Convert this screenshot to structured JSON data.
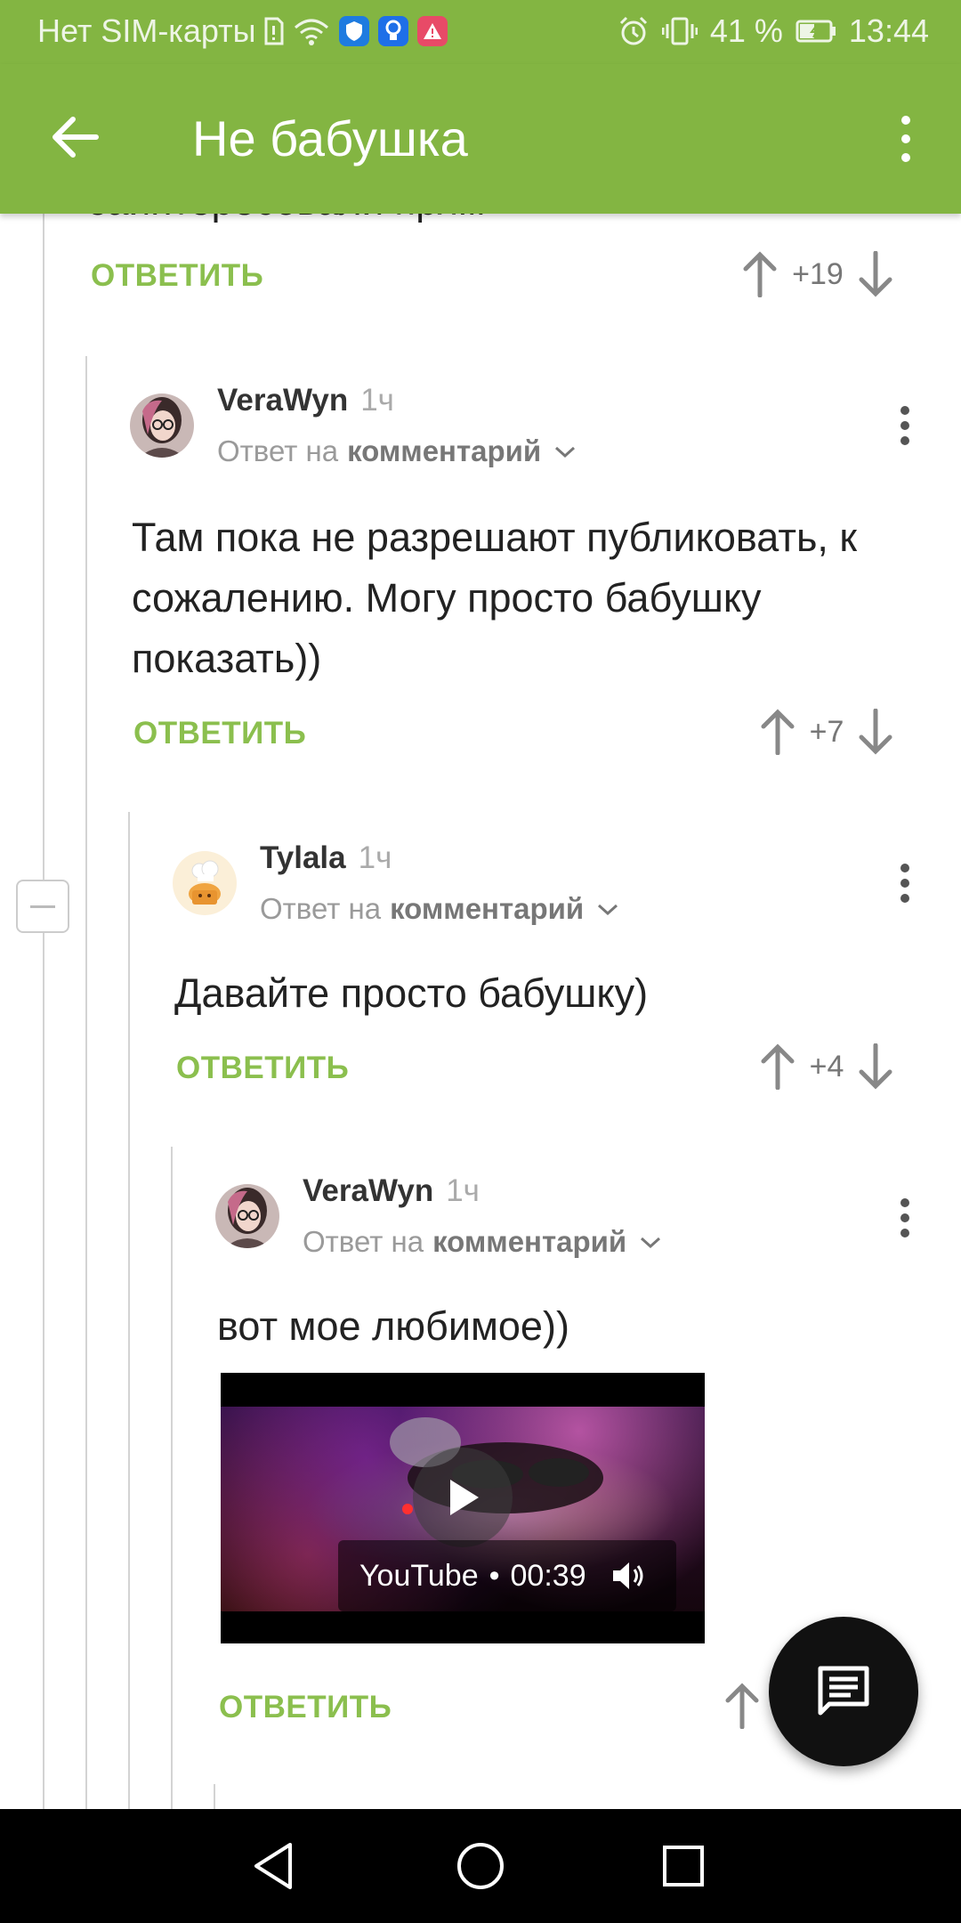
{
  "status_bar": {
    "carrier": "Нет SIM-карты",
    "battery_percent": "41 %",
    "time": "13:44",
    "icons": [
      "sim-icon",
      "wifi-icon",
      "shield-app-icon",
      "bulb-app-icon",
      "warning-app-icon",
      "alarm-icon",
      "vibrate-icon",
      "battery-icon"
    ]
  },
  "appbar": {
    "title": "Не бабушка",
    "back_icon": "arrow-left-icon",
    "menu_icon": "more-vert-icon",
    "background": "#83b542"
  },
  "truncated_comment": {
    "text_fragment": "заинтересовали прям",
    "reply_label": "ОТВЕТИТЬ",
    "score": "+19"
  },
  "comments": [
    {
      "author": "VeraWyn",
      "time": "1ч",
      "reply_prefix": "Ответ на",
      "reply_target": "комментарий",
      "text": "Там пока не разрешают публиковать, к сожалению. Могу просто бабушку показать))",
      "reply_label": "ОТВЕТИТЬ",
      "score": "+7"
    },
    {
      "author": "Tylala",
      "time": "1ч",
      "reply_prefix": "Ответ на",
      "reply_target": "комментарий",
      "text": "Давайте просто бабушку)",
      "reply_label": "ОТВЕТИТЬ",
      "score": "+4"
    },
    {
      "author": "VeraWyn",
      "time": "1ч",
      "reply_prefix": "Ответ на",
      "reply_target": "комментарий",
      "text": "вот мое любимое))",
      "reply_label": "ОТВЕТИТЬ",
      "video": {
        "source": "YouTube",
        "separator": "•",
        "duration": "00:39"
      }
    }
  ],
  "colors": {
    "accent": "#8bbf4e",
    "fab": "#111111"
  }
}
